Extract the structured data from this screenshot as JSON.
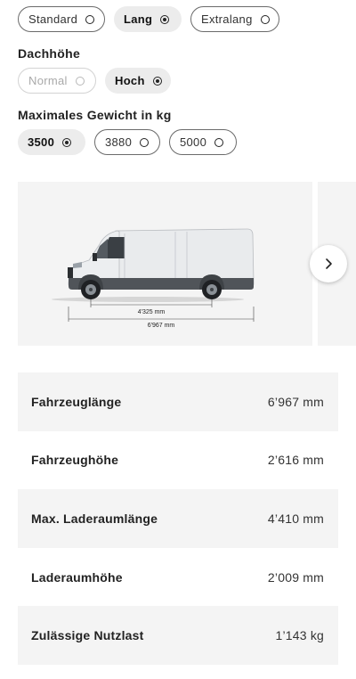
{
  "length_options": [
    {
      "label": "Standard",
      "selected": false
    },
    {
      "label": "Lang",
      "selected": true
    },
    {
      "label": "Extralang",
      "selected": false
    }
  ],
  "roof": {
    "title": "Dachhöhe",
    "options": [
      {
        "label": "Normal",
        "selected": false,
        "disabled": true
      },
      {
        "label": "Hoch",
        "selected": true
      }
    ]
  },
  "weight": {
    "title": "Maximales Gewicht in kg",
    "options": [
      {
        "label": "3500",
        "selected": true
      },
      {
        "label": "3880",
        "selected": false
      },
      {
        "label": "5000",
        "selected": false
      }
    ]
  },
  "gallery": {
    "wheelbase_label": "4'325 mm",
    "length_label": "6'967 mm",
    "van_color": "#e6e8ea"
  },
  "specs": [
    {
      "name": "Fahrzeuglänge",
      "value": "6’967 mm"
    },
    {
      "name": "Fahrzeughöhe",
      "value": "2’616 mm"
    },
    {
      "name": "Max. Laderaumlänge",
      "value": "4’410 mm"
    },
    {
      "name": "Laderaumhöhe",
      "value": "2’009 mm"
    },
    {
      "name": "Zulässige Nutzlast",
      "value": "1’143 kg"
    }
  ]
}
